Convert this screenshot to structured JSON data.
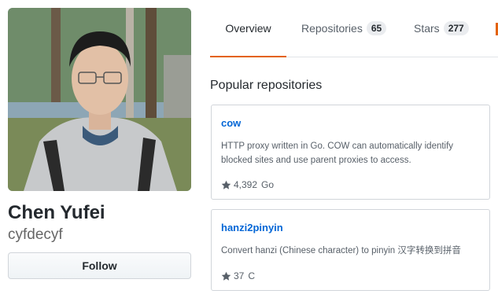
{
  "profile": {
    "fullname": "Chen Yufei",
    "username": "cyfdecyf",
    "follow_label": "Follow"
  },
  "tabs": [
    {
      "label": "Overview",
      "selected": true
    },
    {
      "label": "Repositories",
      "count": "65"
    },
    {
      "label": "Stars",
      "count": "277"
    }
  ],
  "popular": {
    "title": "Popular repositories",
    "repos": [
      {
        "name": "cow",
        "description": "HTTP proxy written in Go. COW can automatically identify blocked sites and use parent proxies to access.",
        "stars": "4,392",
        "language": "Go"
      },
      {
        "name": "hanzi2pinyin",
        "description": "Convert hanzi (Chinese character) to pinyin 汉字转换到拼音",
        "stars": "37",
        "language": "C"
      }
    ]
  },
  "colors": {
    "accent": "#e36209",
    "link": "#0366d6"
  },
  "icons": {
    "star": "star-icon"
  }
}
